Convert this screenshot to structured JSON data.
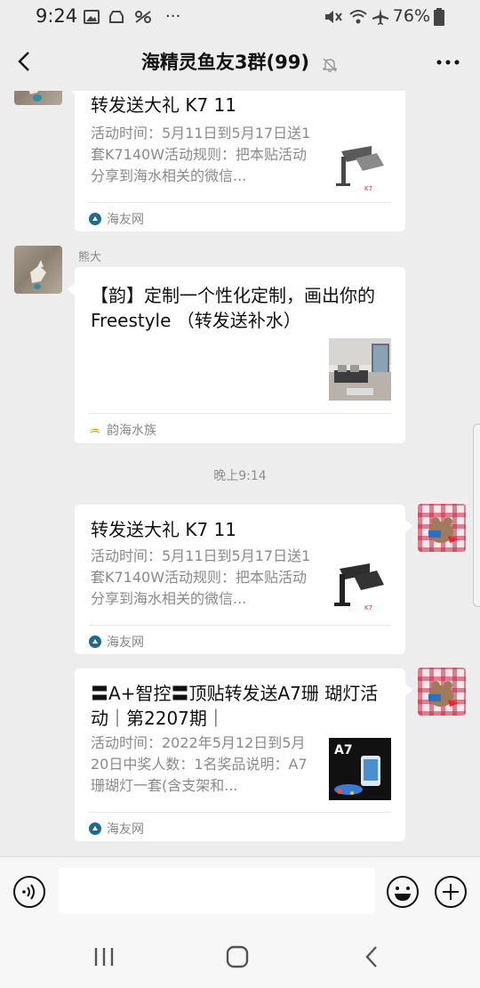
{
  "status_bar": {
    "time": "9:24",
    "battery": "76%"
  },
  "header": {
    "title": "海精灵鱼友3群(99)"
  },
  "messages": [
    {
      "title": "转发送大礼 K7 11",
      "desc": "活动时间：5月11日到5月17日送1套K7140W活动规则：把本贴活动分享到海水相关的微信...",
      "source": "海友网"
    },
    {
      "sender": "熊大",
      "title": "【韵】定制一个性化定制，画出你的Freestyle （转发送补水）",
      "source": "韵海水族"
    },
    {
      "title": "转发送大礼 K7 11",
      "desc": "活动时间：5月11日到5月17日送1套K7140W活动规则：把本贴活动分享到海水相关的微信...",
      "source": "海友网"
    },
    {
      "title": "〓A+智控〓顶贴转发送A7珊 瑚灯活动｜第2207期｜",
      "desc": "活动时间：2022年5月12日到5月20日中奖人数：1名奖品说明：A7珊瑚灯一套(含支架和...",
      "source": "海友网",
      "thumb_label": "A7"
    }
  ],
  "timestamp": "晚上9:14",
  "input": {
    "placeholder": ""
  },
  "colors": {
    "background": "#ededed",
    "bubble": "#ffffff",
    "secondary_text": "#8a8a8a"
  }
}
